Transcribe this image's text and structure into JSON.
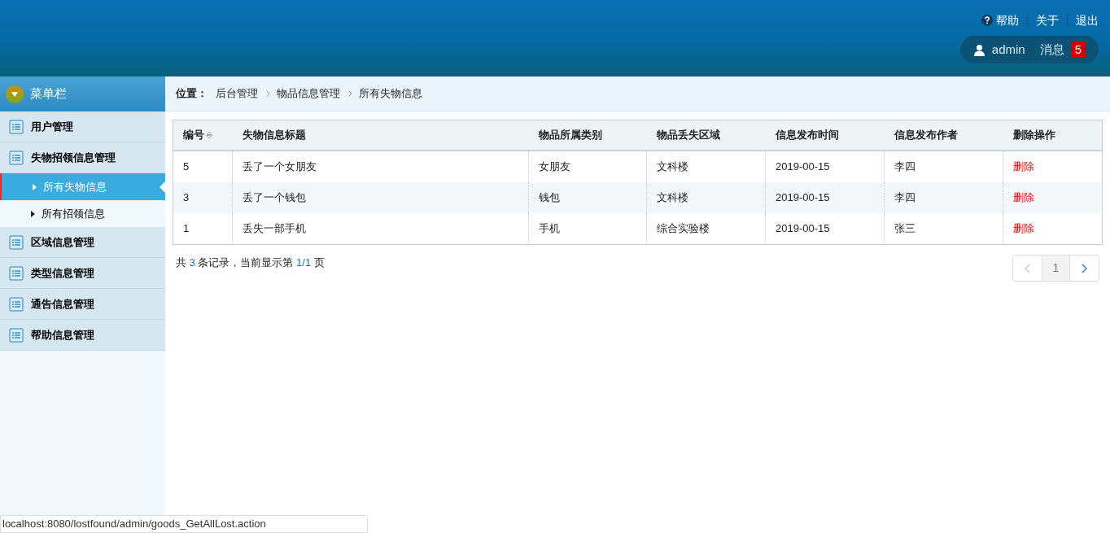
{
  "header": {
    "links": [
      {
        "label": "帮助",
        "kind": "help"
      },
      {
        "label": "关于",
        "kind": "plain"
      },
      {
        "label": "退出",
        "kind": "plain"
      }
    ],
    "user": "admin",
    "messages": {
      "label": "消息",
      "count": "5"
    }
  },
  "sidebar": {
    "title": "菜单栏",
    "items": [
      {
        "label": "用户管理"
      },
      {
        "label": "失物招领信息管理",
        "children": [
          {
            "label": "所有失物信息",
            "selected": true
          },
          {
            "label": "所有招领信息",
            "selected": false
          }
        ]
      },
      {
        "label": "区域信息管理"
      },
      {
        "label": "类型信息管理"
      },
      {
        "label": "通告信息管理"
      },
      {
        "label": "帮助信息管理"
      }
    ]
  },
  "breadcrumb": {
    "label": "位置：",
    "items": [
      "后台管理",
      "物品信息管理",
      "所有失物信息"
    ]
  },
  "table": {
    "columns": [
      {
        "label": "编号",
        "sortable": true
      },
      {
        "label": "失物信息标题",
        "sortable": false
      },
      {
        "label": "物品所属类别",
        "sortable": false
      },
      {
        "label": "物品丢失区域",
        "sortable": false
      },
      {
        "label": "信息发布时间",
        "sortable": false
      },
      {
        "label": "信息发布作者",
        "sortable": false
      },
      {
        "label": "删除操作",
        "sortable": false
      }
    ],
    "rows": [
      {
        "cells": [
          "5",
          "丢了一个女朋友",
          "女朋友",
          "文科楼",
          "2019-00-15",
          "李四"
        ],
        "action": "删除"
      },
      {
        "cells": [
          "3",
          "丢了一个钱包",
          "钱包",
          "文科楼",
          "2019-00-15",
          "李四"
        ],
        "action": "删除"
      },
      {
        "cells": [
          "1",
          "丢失一部手机",
          "手机",
          "综合实验楼",
          "2019-00-15",
          "张三"
        ],
        "action": "删除"
      }
    ]
  },
  "summary": {
    "prefix": "共",
    "total": "3",
    "middle": "条记录，当前显示第",
    "page": "1/1",
    "suffix": "页"
  },
  "pagination": {
    "prev_disabled": true,
    "next_disabled": false,
    "pages": [
      {
        "label": "1",
        "selected": true
      }
    ]
  },
  "status_bar": "localhost:8080/lostfound/admin/goods_GetAllLost.action"
}
